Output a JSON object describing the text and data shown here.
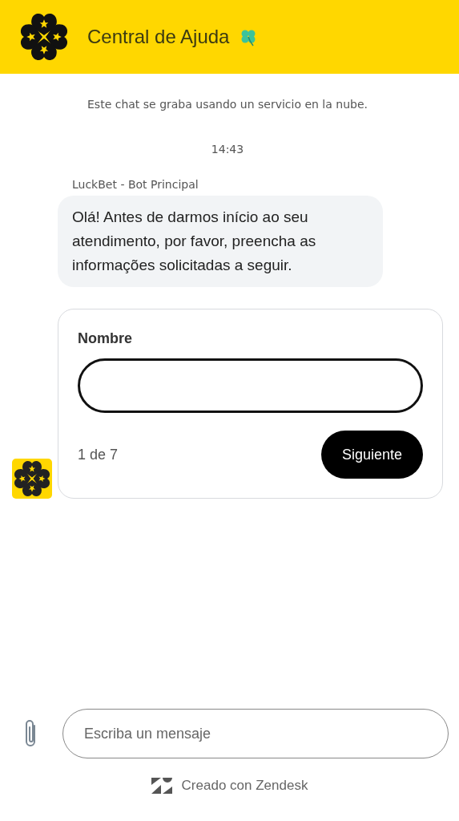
{
  "header": {
    "title": "Central de Ajuda"
  },
  "notice": "Este chat se graba usando un servicio en la nube.",
  "timestamp": "14:43",
  "messages": [
    {
      "sender": "LuckBet - Bot Principal",
      "text": "Olá! Antes de darmos início ao seu atendimento, por favor, preencha as informações solicitadas a seguir."
    }
  ],
  "form": {
    "label": "Nombre",
    "step": "1 de 7",
    "button": "Siguiente"
  },
  "composer": {
    "placeholder": "Escriba un mensaje"
  },
  "footer": "Creado con Zendesk"
}
